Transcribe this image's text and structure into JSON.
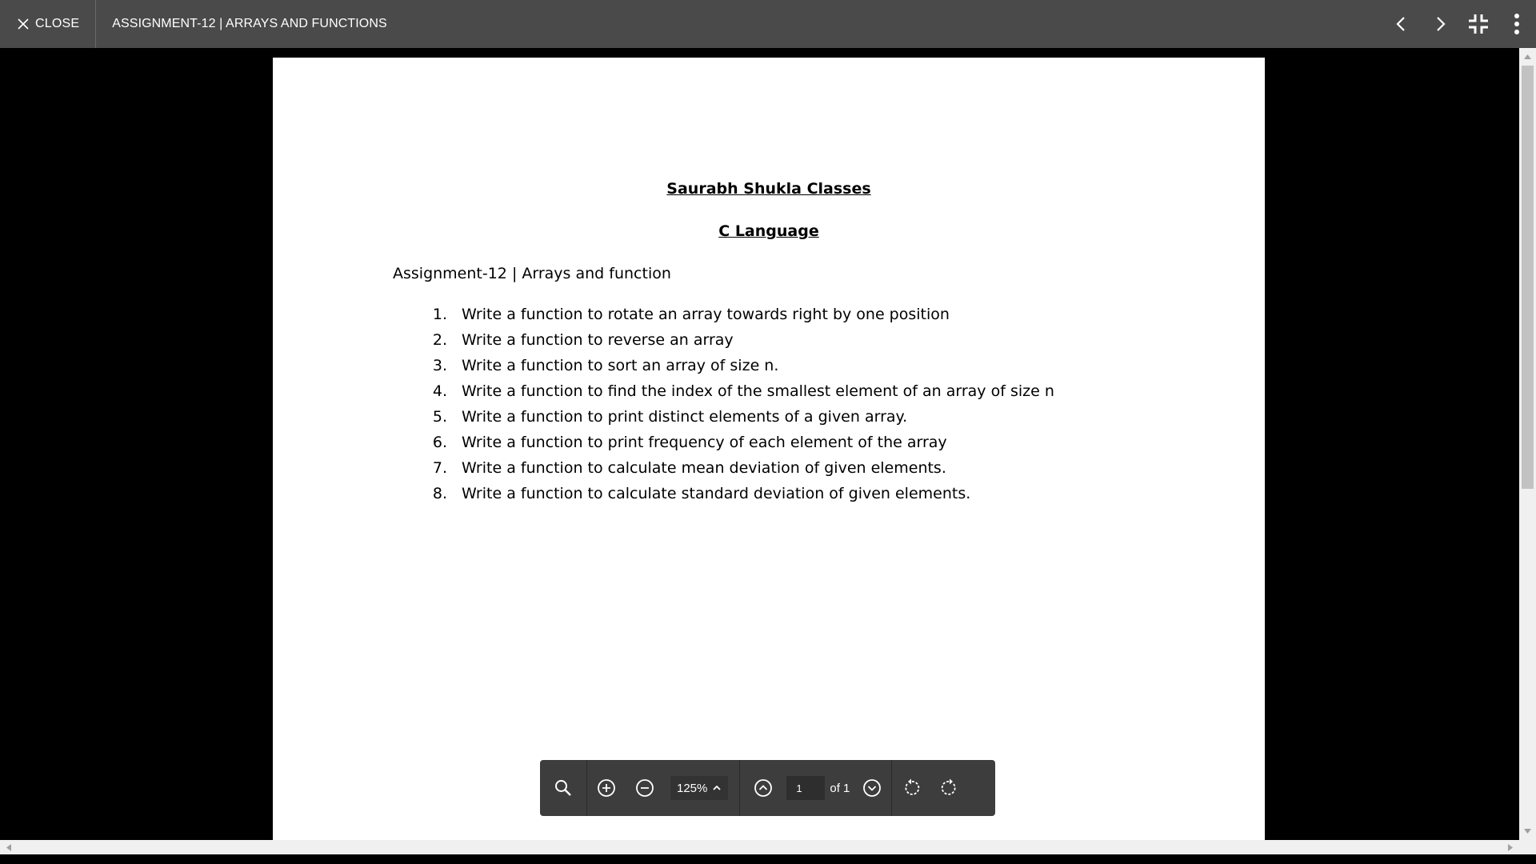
{
  "topbar": {
    "close_label": "CLOSE",
    "title": "ASSIGNMENT-12 | ARRAYS AND FUNCTIONS",
    "icons": [
      "close-icon",
      "chevron-left-icon",
      "chevron-right-icon",
      "exit-fullscreen-icon",
      "more-vertical-icon"
    ]
  },
  "document": {
    "heading": "Saurabh Shukla Classes",
    "subheading": "C Language",
    "subtitle": "Assignment-12 | Arrays and function",
    "tasks": [
      {
        "num": "1.",
        "text": "Write a function to rotate an array towards right by one position"
      },
      {
        "num": "2.",
        "text": "Write a function to reverse an array"
      },
      {
        "num": "3.",
        "text": "Write a function to sort an array of size n."
      },
      {
        "num": "4.",
        "text": "Write a function to find the index of the smallest element of an array of size n"
      },
      {
        "num": "5.",
        "text": "Write a function to print distinct elements of a given array."
      },
      {
        "num": "6.",
        "text": "Write a function to print frequency of each element of the array"
      },
      {
        "num": "7.",
        "text": "Write a function to calculate mean deviation of given elements."
      },
      {
        "num": "8.",
        "text": "Write a function to calculate standard deviation of given elements."
      }
    ]
  },
  "toolbar": {
    "zoom_level": "125%",
    "current_page": "1",
    "of_label": "of 1",
    "icons": [
      "search-icon",
      "zoom-in-icon",
      "zoom-out-icon",
      "chevron-up-icon",
      "previous-page-icon",
      "next-page-icon",
      "rotate-left-icon",
      "rotate-right-icon"
    ]
  },
  "colors": {
    "topbar_bg": "#4a4a4a",
    "toolbar_bg": "#3d3d3d",
    "viewer_bg": "#000000",
    "page_bg": "#ffffff"
  }
}
